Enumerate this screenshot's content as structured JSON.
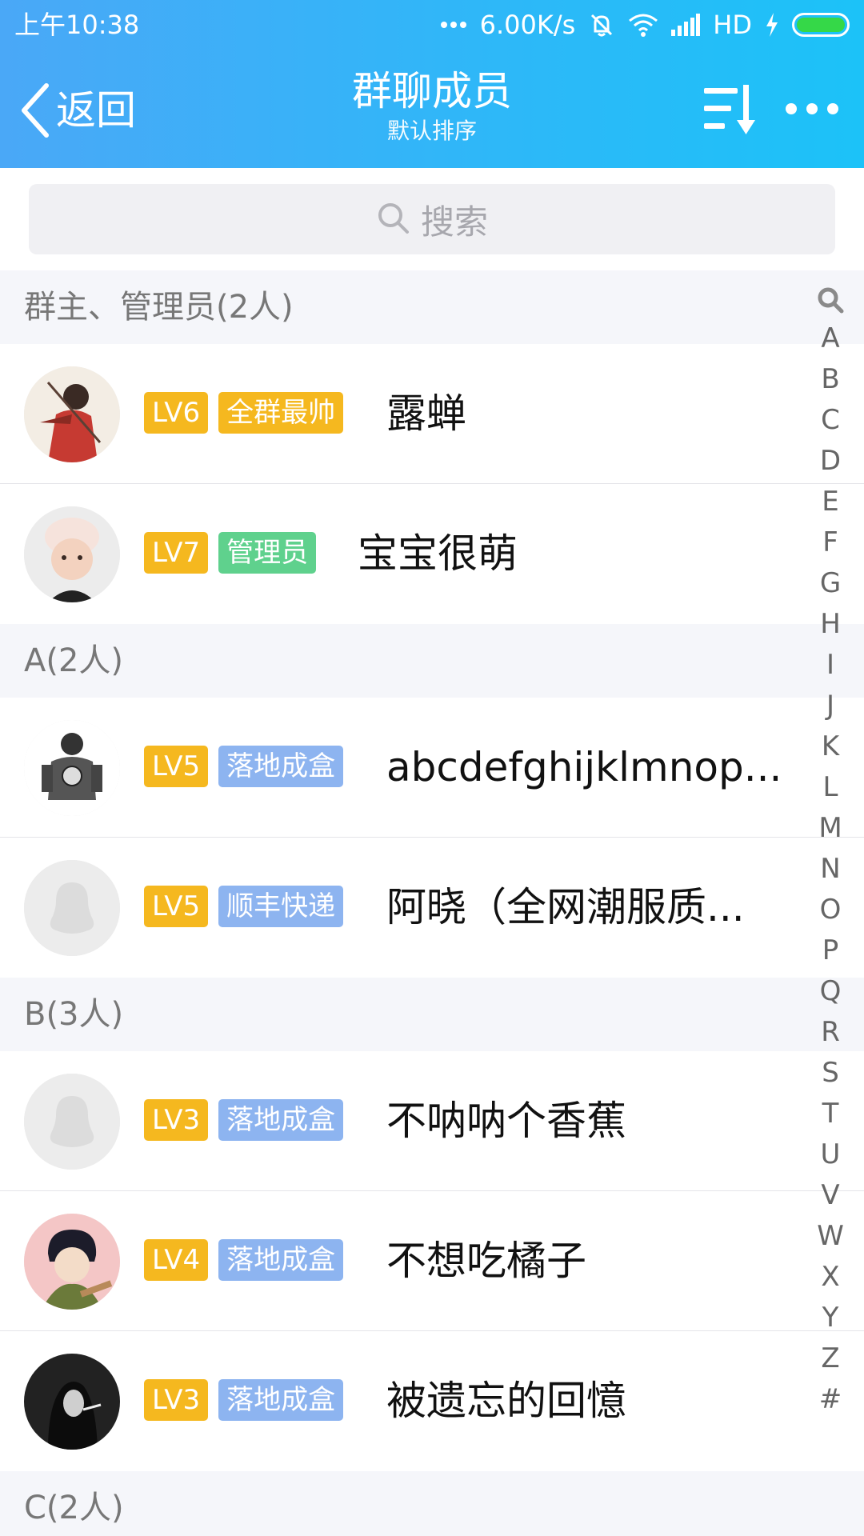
{
  "status_bar": {
    "time": "上午10:38",
    "network_speed": "6.00K/s",
    "network_type": "HD",
    "battery_color": "#35d848"
  },
  "header": {
    "back_label": "返回",
    "title": "群聊成员",
    "subtitle": "默认排序",
    "icons": [
      "back-chevron-icon",
      "sort-icon",
      "more-icon"
    ]
  },
  "search": {
    "placeholder": "搜索"
  },
  "sections": [
    {
      "header": "群主、管理员(2人)",
      "members": [
        {
          "level": "LV6",
          "title": "全群最帅",
          "title_color": "#f5b81f",
          "name": "露蝉"
        },
        {
          "level": "LV7",
          "title": "管理员",
          "title_color": "#5fd18d",
          "name": "宝宝很萌"
        }
      ]
    },
    {
      "header": "A(2人)",
      "members": [
        {
          "level": "LV5",
          "title": "落地成盒",
          "title_color": "#8db4f0",
          "name": "abcdefghijklmnop..."
        },
        {
          "level": "LV5",
          "title": "顺丰快递",
          "title_color": "#8db4f0",
          "name": "阿晓（全网潮服质..."
        }
      ]
    },
    {
      "header": "B(3人)",
      "members": [
        {
          "level": "LV3",
          "title": "落地成盒",
          "title_color": "#8db4f0",
          "name": "不呐呐个香蕉"
        },
        {
          "level": "LV4",
          "title": "落地成盒",
          "title_color": "#8db4f0",
          "name": "不想吃橘子"
        },
        {
          "level": "LV3",
          "title": "落地成盒",
          "title_color": "#8db4f0",
          "name": "被遗忘的回憶"
        }
      ]
    },
    {
      "header": "C(2人)",
      "members": []
    }
  ],
  "alphabet_index": [
    "A",
    "B",
    "C",
    "D",
    "E",
    "F",
    "G",
    "H",
    "I",
    "J",
    "K",
    "L",
    "M",
    "N",
    "O",
    "P",
    "Q",
    "R",
    "S",
    "T",
    "U",
    "V",
    "W",
    "X",
    "Y",
    "Z",
    "#"
  ],
  "colors": {
    "header_gradient_start": "#4aa8f7",
    "header_gradient_end": "#1cc2f8",
    "level_badge": "#f5b81f"
  }
}
